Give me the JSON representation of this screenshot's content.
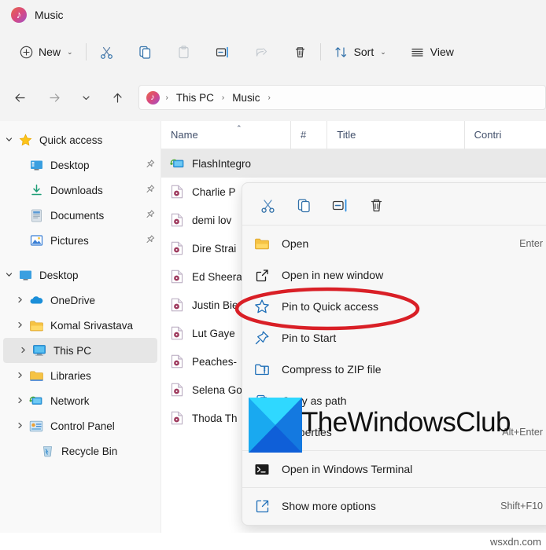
{
  "window": {
    "title": "Music",
    "title_icon": "music-note-icon"
  },
  "commandbar": {
    "new_label": "New",
    "new_icon": "plus-circle-icon",
    "cut_icon": "scissors-icon",
    "copy_icon": "copy-icon",
    "paste_icon": "clipboard-icon",
    "rename_icon": "rename-icon",
    "share_icon": "share-icon",
    "delete_icon": "trash-icon",
    "sort_label": "Sort",
    "sort_icon": "sort-arrows-icon",
    "view_label": "View",
    "view_icon": "hamburger-lines-icon",
    "chevron": "⌄"
  },
  "navbar": {
    "back_icon": "arrow-left-icon",
    "forward_icon": "arrow-right-icon",
    "recent_icon": "chevron-down-icon",
    "up_icon": "arrow-up-icon",
    "address_icon": "music-note-icon",
    "breadcrumbs": [
      "This PC",
      "Music"
    ],
    "separator": "›"
  },
  "sidebar": {
    "items": [
      {
        "label": "Quick access",
        "icon": "star-icon",
        "twisty": "expanded",
        "level": 0,
        "pinned": false,
        "selected": false
      },
      {
        "label": "Desktop",
        "icon": "desktop-icon",
        "twisty": "none",
        "level": 1,
        "pinned": true,
        "selected": false
      },
      {
        "label": "Downloads",
        "icon": "downloads-icon",
        "twisty": "none",
        "level": 1,
        "pinned": true,
        "selected": false
      },
      {
        "label": "Documents",
        "icon": "documents-icon",
        "twisty": "none",
        "level": 1,
        "pinned": true,
        "selected": false
      },
      {
        "label": "Pictures",
        "icon": "pictures-icon",
        "twisty": "none",
        "level": 1,
        "pinned": true,
        "selected": false
      },
      {
        "label": "Desktop",
        "icon": "desktop-icon",
        "twisty": "expanded",
        "level": 0,
        "pinned": false,
        "selected": false
      },
      {
        "label": "OneDrive",
        "icon": "onedrive-cloud-icon",
        "twisty": "collapsed",
        "level": 1,
        "pinned": false,
        "selected": false
      },
      {
        "label": "Komal Srivastava",
        "icon": "folder-user-icon",
        "twisty": "collapsed",
        "level": 1,
        "pinned": false,
        "selected": false
      },
      {
        "label": "This PC",
        "icon": "this-pc-icon",
        "twisty": "collapsed",
        "level": 1,
        "pinned": false,
        "selected": true
      },
      {
        "label": "Libraries",
        "icon": "libraries-folder-icon",
        "twisty": "collapsed",
        "level": 1,
        "pinned": false,
        "selected": false
      },
      {
        "label": "Network",
        "icon": "network-icon",
        "twisty": "collapsed",
        "level": 1,
        "pinned": false,
        "selected": false
      },
      {
        "label": "Control Panel",
        "icon": "control-panel-icon",
        "twisty": "collapsed",
        "level": 1,
        "pinned": false,
        "selected": false
      },
      {
        "label": "Recycle Bin",
        "icon": "recycle-bin-icon",
        "twisty": "none",
        "level": 1,
        "pinned": false,
        "selected": false
      }
    ]
  },
  "filelist": {
    "columns": [
      {
        "label": "Name",
        "sorted": "asc"
      },
      {
        "label": "#",
        "sorted": "none"
      },
      {
        "label": "Title",
        "sorted": "none"
      },
      {
        "label": "Contri",
        "sorted": "none"
      }
    ],
    "sort_caret": "⌃",
    "rows": [
      {
        "name": "FlashIntegro",
        "icon": "network-computer-icon",
        "selected": true
      },
      {
        "name": "Charlie P",
        "icon": "audio-file-icon",
        "selected": false
      },
      {
        "name": "demi lov",
        "icon": "audio-file-icon",
        "selected": false
      },
      {
        "name": "Dire Strai",
        "icon": "audio-file-icon",
        "selected": false
      },
      {
        "name": "Ed Sheera",
        "icon": "audio-file-icon",
        "selected": false
      },
      {
        "name": "Justin Bie",
        "icon": "audio-file-icon",
        "selected": false
      },
      {
        "name": "Lut Gaye",
        "icon": "audio-file-icon",
        "selected": false
      },
      {
        "name": "Peaches-",
        "icon": "audio-file-icon",
        "selected": false
      },
      {
        "name": "Selena Go",
        "icon": "audio-file-icon",
        "selected": false
      },
      {
        "name": "Thoda Th",
        "icon": "audio-file-icon",
        "selected": false
      }
    ]
  },
  "context_menu": {
    "toolbar": [
      {
        "icon": "scissors-icon",
        "name": "cut"
      },
      {
        "icon": "copy-icon",
        "name": "copy"
      },
      {
        "icon": "rename-icon",
        "name": "rename"
      },
      {
        "icon": "trash-icon",
        "name": "delete"
      }
    ],
    "items": [
      {
        "label": "Open",
        "accel": "Enter",
        "icon": "folder-open-icon",
        "highlighted": false
      },
      {
        "label": "Open in new window",
        "accel": "",
        "icon": "external-window-icon",
        "highlighted": false
      },
      {
        "label": "Pin to Quick access",
        "accel": "",
        "icon": "star-outline-icon",
        "highlighted": true
      },
      {
        "label": "Pin to Start",
        "accel": "",
        "icon": "pin-icon",
        "highlighted": false
      },
      {
        "label": "Compress to ZIP file",
        "accel": "",
        "icon": "zip-folder-icon",
        "highlighted": false
      },
      {
        "label": "Copy as path",
        "accel": "",
        "icon": "copy-path-icon",
        "highlighted": false
      },
      {
        "label": "Properties",
        "accel": "Alt+Enter",
        "icon": "properties-icon",
        "highlighted": false
      },
      {
        "label": "Open in Windows Terminal",
        "accel": "",
        "icon": "terminal-icon",
        "highlighted": false,
        "divider_before": true
      },
      {
        "label": "Show more options",
        "accel": "Shift+F10",
        "icon": "show-more-icon",
        "highlighted": false,
        "divider_before": true
      }
    ]
  },
  "annotations": {
    "ellipse_color": "#d91f26",
    "ellipse_target": "Pin to Quick access"
  },
  "watermarks": {
    "brand": "TheWindowsClub",
    "site": "wsxdn.com"
  },
  "colors": {
    "accent_blue": "#0f6cbd",
    "chrome_bg": "#f3f3f3",
    "panel_bg": "#f9f9f9",
    "selection": "#e6e6e6",
    "annotation_red": "#d91f26"
  }
}
